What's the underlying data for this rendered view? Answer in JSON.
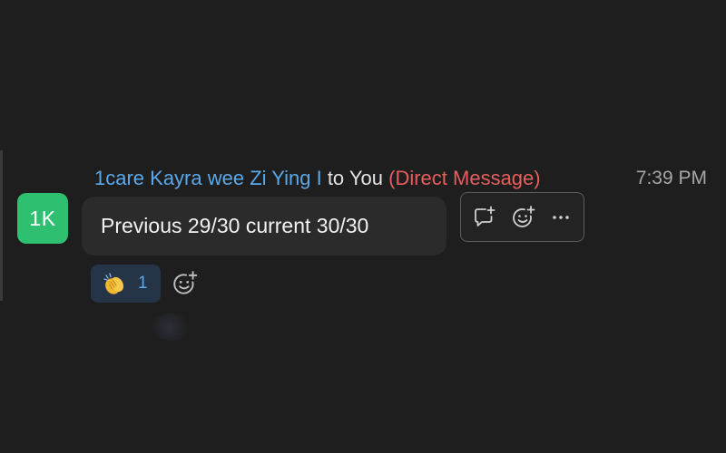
{
  "message": {
    "avatar_initials": "1K",
    "avatar_color": "#2fbf71",
    "sender_name": "1care Kayra wee Zi Ying I",
    "to_label": "to You",
    "dm_label": "(Direct Message)",
    "time": "7:39 PM",
    "text": "Previous 29/30 current 30/30"
  },
  "actions": {
    "reply_icon": "comment-plus-icon",
    "reaction_icon": "smiley-plus-icon",
    "more_icon": "more-horizontal-icon"
  },
  "reactions": [
    {
      "emoji_icon": "clapping-hands-icon",
      "count": "1"
    }
  ],
  "colors": {
    "background": "#1e1e1e",
    "bubble": "#2b2b2b",
    "sender": "#5aa7ea",
    "direct_message": "#e85d5d",
    "reaction_bg": "#253447"
  }
}
